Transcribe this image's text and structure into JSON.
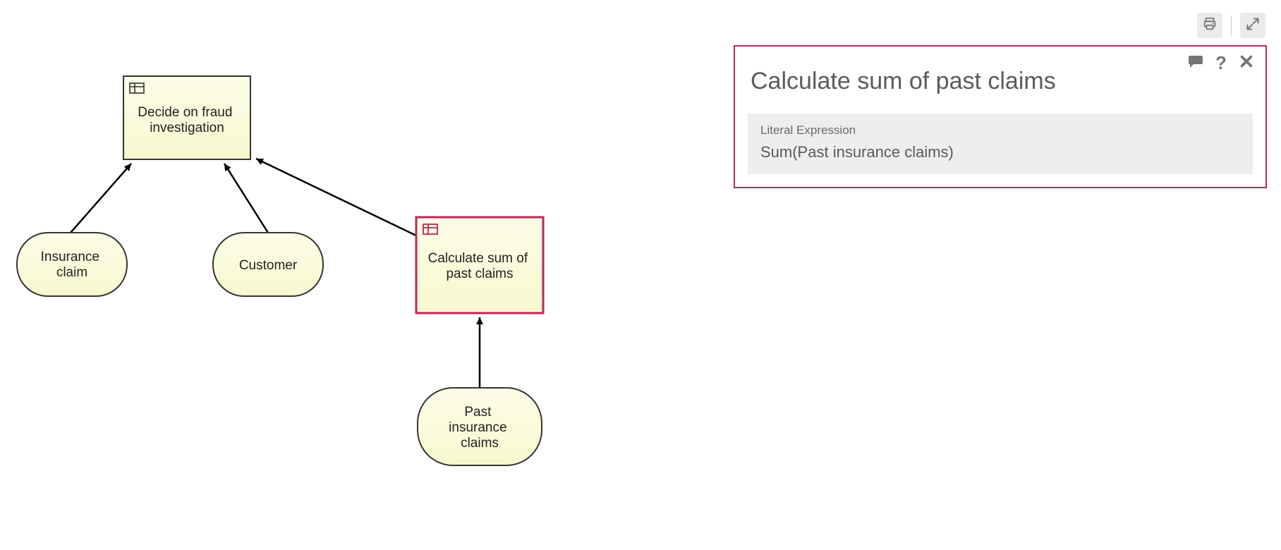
{
  "toolbar": {
    "printIcon": "print-icon",
    "expandIcon": "expand-icon"
  },
  "panel": {
    "title": "Calculate sum of past claims",
    "expressionLabel": "Literal Expression",
    "expressionValue": "Sum(Past insurance claims)",
    "actions": {
      "commentIcon": "comment-icon",
      "helpIcon": "help-icon",
      "closeIcon": "close-icon"
    },
    "helpGlyph": "?"
  },
  "diagram": {
    "colors": {
      "nodeFill": "#fbfbdc",
      "nodeStroke": "#353535",
      "selectedStroke": "#b7295a",
      "iconStroke": "#333333",
      "iconStrokeSelected": "#b7295a"
    },
    "nodes": {
      "decide": {
        "type": "decision",
        "line1": "Decide on fraud",
        "line2": "investigation"
      },
      "calc": {
        "type": "decision",
        "selected": true,
        "line1": "Calculate sum of",
        "line2": "past claims"
      },
      "claim": {
        "type": "input",
        "line1": "Insurance",
        "line2": "claim"
      },
      "customer": {
        "type": "input",
        "line1": "Customer"
      },
      "pastClaims": {
        "type": "input",
        "line1": "Past",
        "line2": "insurance",
        "line3": "claims"
      }
    },
    "edges": [
      {
        "from": "claim",
        "to": "decide"
      },
      {
        "from": "customer",
        "to": "decide"
      },
      {
        "from": "calc",
        "to": "decide"
      },
      {
        "from": "pastClaims",
        "to": "calc"
      }
    ]
  }
}
